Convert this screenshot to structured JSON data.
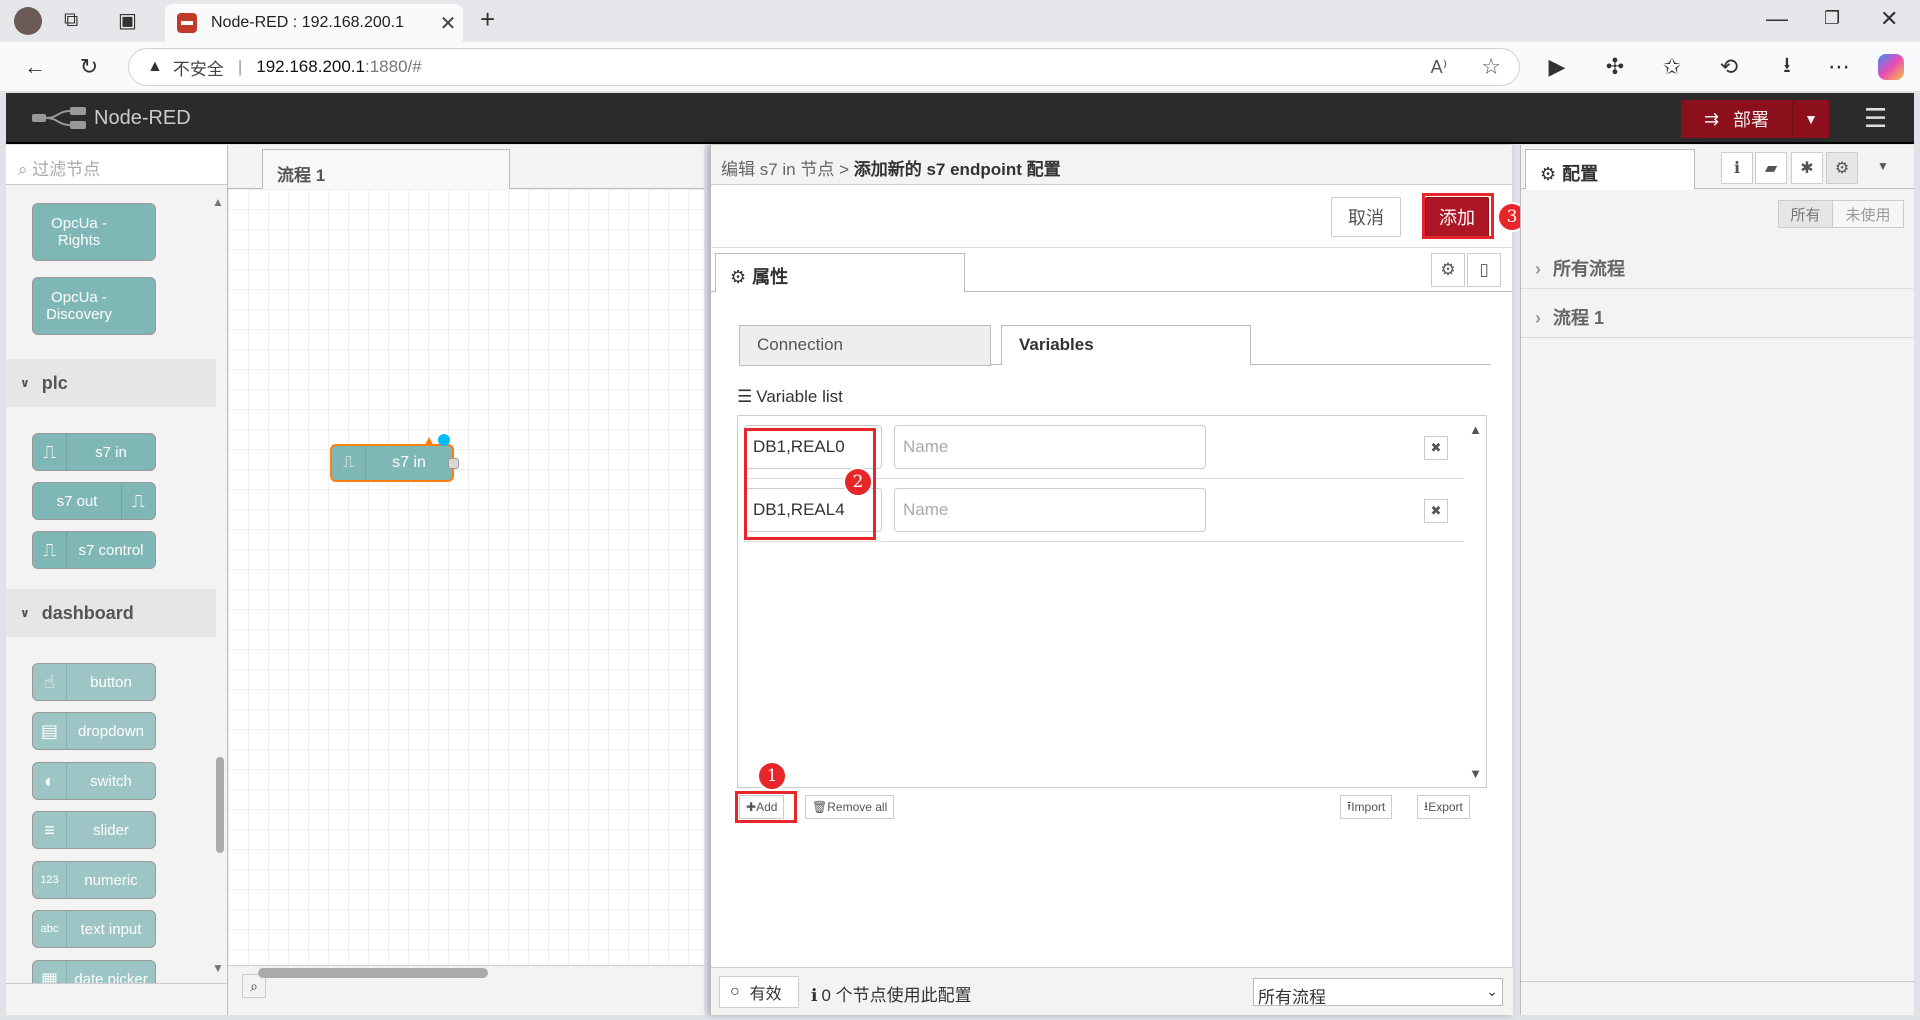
{
  "browser": {
    "tab_title": "Node-RED : 192.168.200.1",
    "insecure_label": "不安全",
    "url_host": "192.168.200.1",
    "url_rest": ":1880/#"
  },
  "app": {
    "name": "Node-RED",
    "deploy_label": "部署"
  },
  "palette": {
    "filter_placeholder": "过滤节点",
    "opcua_nodes": [
      {
        "line1": "OpcUa -",
        "line2": "Rights"
      },
      {
        "line1": "OpcUa -",
        "line2": "Discovery"
      }
    ],
    "categories": {
      "plc": "plc",
      "dashboard": "dashboard"
    },
    "plc_nodes": [
      "s7 in",
      "s7 out",
      "s7 control"
    ],
    "dashboard_nodes": [
      "button",
      "dropdown",
      "switch",
      "slider",
      "numeric",
      "text input",
      "date picker"
    ]
  },
  "workspace": {
    "tab_label": "流程 1",
    "node_label": "s7 in"
  },
  "editor": {
    "breadcrumb_prefix": "编辑 s7 in 节点 >",
    "breadcrumb_title": "添加新的 s7 endpoint 配置",
    "cancel_label": "取消",
    "add_label": "添加",
    "properties_tab": "属性",
    "subtabs": [
      "Connection",
      "Variables"
    ],
    "variable_list_label": "Variable list",
    "name_placeholder": "Name",
    "variables": [
      {
        "address": "DB1,REAL0"
      },
      {
        "address": "DB1,REAL4"
      }
    ],
    "buttons": {
      "add": "Add",
      "remove_all": "Remove all",
      "import": "Import",
      "export": "Export"
    },
    "footer": {
      "enabled_label": "有效",
      "usage_text": "0 个节点使用此配置",
      "scope_value": "所有流程"
    },
    "annotations": [
      "1",
      "2",
      "3"
    ]
  },
  "sidebar": {
    "tab_label": "配置",
    "filter_all": "所有",
    "filter_unused": "未使用",
    "rows": [
      "所有流程",
      "流程 1"
    ]
  },
  "colors": {
    "deploy": "#8c101c",
    "highlight": "#e8262a",
    "node_plc": "#7fb7b7"
  }
}
